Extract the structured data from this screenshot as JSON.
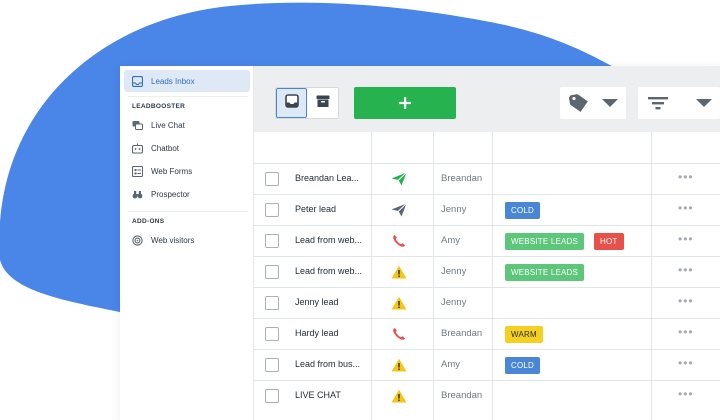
{
  "colors": {
    "blob": "#4a86e8",
    "accent": "#2f6fbd",
    "add_button": "#26b24f",
    "toolbar_bg": "#eceeef"
  },
  "sidebar": {
    "inbox_label": "Leads Inbox",
    "section_leadbooster": "LEADBOOSTER",
    "items": [
      {
        "label": "Live Chat",
        "icon": "live-chat-icon"
      },
      {
        "label": "Chatbot",
        "icon": "chatbot-icon"
      },
      {
        "label": "Web Forms",
        "icon": "web-forms-icon"
      },
      {
        "label": "Prospector",
        "icon": "binoculars-icon"
      }
    ],
    "section_addons": "ADD-ONS",
    "addons": [
      {
        "label": "Web visitors",
        "icon": "web-visitors-icon"
      }
    ]
  },
  "toolbar": {
    "add_label": "+",
    "icons": [
      "inbox-icon",
      "archive-icon",
      "tag-icon",
      "filter-icon",
      "chevron-down-icon"
    ]
  },
  "leads": [
    {
      "title": "Breandan Lea...",
      "source": "send-icon",
      "source_color": "#26b24f",
      "owner": "Breandan",
      "labels": []
    },
    {
      "title": "Peter lead",
      "source": "send-icon",
      "source_color": "#5b6670",
      "owner": "Jenny",
      "labels": [
        {
          "text": "COLD",
          "kind": "cold"
        }
      ]
    },
    {
      "title": "Lead from web...",
      "source": "phone-icon",
      "source_color": "#e8514a",
      "owner": "Amy",
      "labels": [
        {
          "text": "WEBSITE LEADS",
          "kind": "web"
        },
        {
          "text": "HOT",
          "kind": "hot"
        }
      ]
    },
    {
      "title": "Lead from web...",
      "source": "warning-icon",
      "source_color": "#f5c518",
      "owner": "Jenny",
      "labels": [
        {
          "text": "WEBSITE LEADS",
          "kind": "web"
        }
      ]
    },
    {
      "title": "Jenny lead",
      "source": "warning-icon",
      "source_color": "#f5c518",
      "owner": "Jenny",
      "labels": []
    },
    {
      "title": "Hardy lead",
      "source": "phone-icon",
      "source_color": "#e8514a",
      "owner": "Breandan",
      "labels": [
        {
          "text": "WARM",
          "kind": "warm"
        }
      ]
    },
    {
      "title": "Lead from bus...",
      "source": "warning-icon",
      "source_color": "#f5c518",
      "owner": "Amy",
      "labels": [
        {
          "text": "COLD",
          "kind": "cold"
        }
      ]
    },
    {
      "title": "LIVE CHAT",
      "source": "warning-icon",
      "source_color": "#f5c518",
      "owner": "Breandan",
      "labels": []
    }
  ],
  "row_menu": "•••"
}
